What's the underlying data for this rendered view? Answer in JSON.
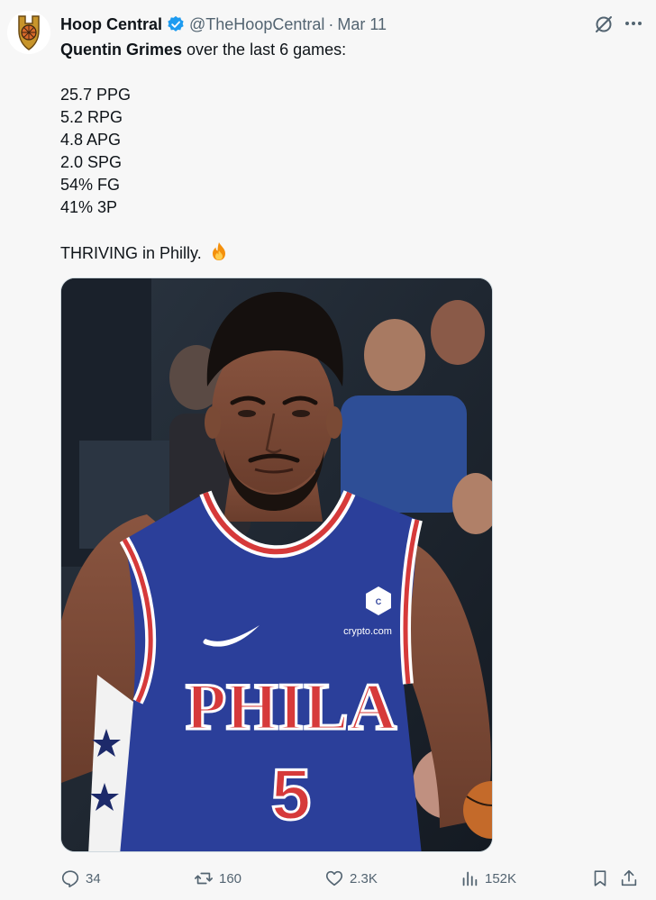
{
  "author": {
    "display_name": "Hoop Central",
    "handle": "@TheHoopCentral",
    "separator": "·",
    "date": "Mar 11",
    "verified": true,
    "avatar_icon": "hoop-central-logo"
  },
  "tweet": {
    "lead_bold": "Quentin Grimes",
    "lead_rest": " over the last 6 games:",
    "stats": [
      "25.7 PPG",
      "5.2 RPG",
      "4.8 APG",
      "2.0 SPG",
      "54% FG",
      "41% 3P"
    ],
    "closing": "THRIVING in Philly.",
    "closing_emoji": "fire-emoji"
  },
  "media": {
    "jersey_word": "PHILA",
    "jersey_number": "5",
    "sponsor": "crypto.com",
    "colors": {
      "jersey": "#2b3f9a",
      "trim": "#d63a3a",
      "skin": "#7a4a35",
      "court_bg": "#1d2530"
    }
  },
  "actions": {
    "replies": "34",
    "retweets": "160",
    "likes": "2.3K",
    "views": "152K"
  },
  "colors": {
    "text": "#0f1419",
    "muted": "#536471",
    "verified_blue": "#1d9bf0",
    "background": "#f7f7f7"
  }
}
